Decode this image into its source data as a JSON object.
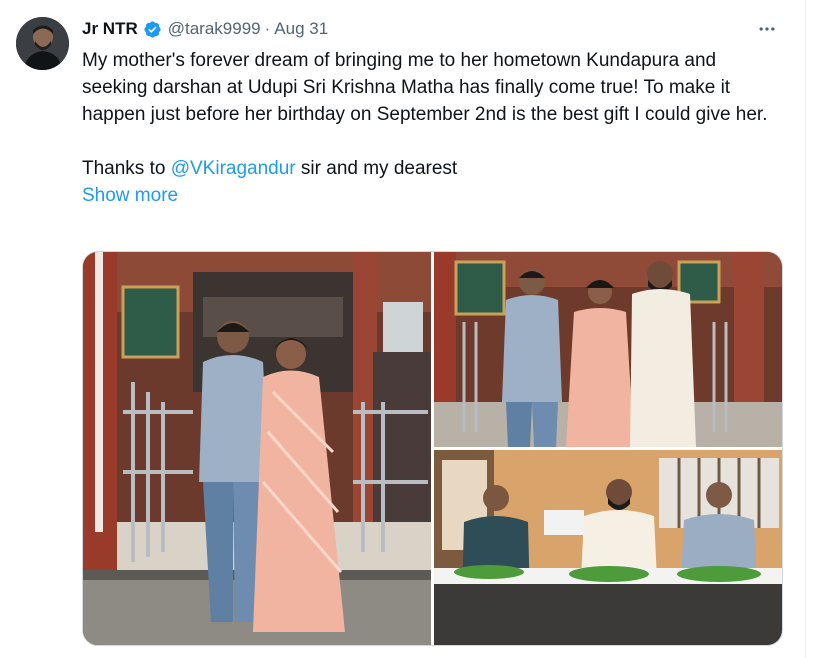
{
  "tweet": {
    "author_name": "Jr NTR",
    "handle": "@tarak9999",
    "separator": "·",
    "timestamp": "Aug 31",
    "more_icon": "more-dots-icon",
    "verified_icon": "verified-badge-icon",
    "verified_color": "#1d9bf0",
    "text_line1": "My mother's forever dream of bringing me to her hometown Kundapura and seeking darshan at Udupi Sri Krishna Matha has finally come true! To make it happen just before her birthday on September 2nd is the best gift I could give her.",
    "thanks_prefix": "Thanks to ",
    "mention": "@VKiragandur",
    "thanks_suffix": " sir and my dearest",
    "show_more": "Show more",
    "link_color": "#1d9bf0"
  }
}
